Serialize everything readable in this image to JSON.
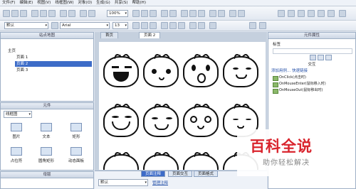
{
  "menu": [
    "文件(F)",
    "编辑(E)",
    "视图(V)",
    "线框图(W)",
    "对象(O)",
    "生成(G)",
    "共享(S)",
    "帮助(H)"
  ],
  "toolbar": {
    "zoom": "100%",
    "style_select": "默认",
    "font_select": "Arial",
    "font_size": "13"
  },
  "sitemap": {
    "title": "站点地图",
    "items": [
      "主页",
      "页面 1",
      "页面 2",
      "页面 3"
    ],
    "selected": "页面 2"
  },
  "widgets": {
    "title": "元件",
    "dropdown": "线框图",
    "items": [
      "图片",
      "文本",
      "矩形",
      "占位符",
      "圆角矩形",
      "动态面板"
    ]
  },
  "master": {
    "title": "母版"
  },
  "editor": {
    "tabs": [
      "首页",
      "页面 2"
    ],
    "active_tab": "页面 2"
  },
  "props": {
    "title": "元件属性",
    "label_field": "标签",
    "subtitle": "交互",
    "link": "添加用例... 快速链接",
    "events": [
      "OnClick(点击时)",
      "OnMouseEnter(鼠标移入时)",
      "OnMouseOut(鼠标移出时)"
    ]
  },
  "bottom": {
    "tabs": [
      "页面注释",
      "页面交互",
      "页面格式"
    ],
    "select": "默认",
    "link": "管理注释"
  },
  "watermark": {
    "title": "百科全说",
    "subtitle": "助你轻松解决"
  }
}
